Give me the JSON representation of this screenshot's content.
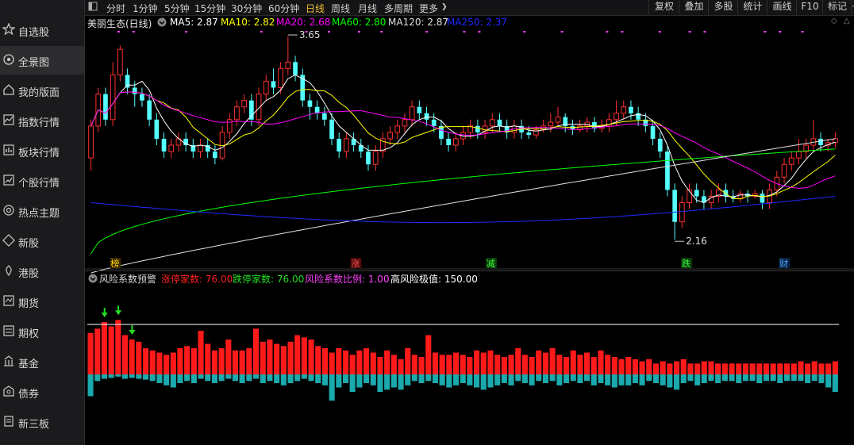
{
  "sidebar": {
    "items": [
      {
        "label": "自选股",
        "icon": "star-icon",
        "active": false
      },
      {
        "label": "全景图",
        "icon": "globe-icon",
        "active": true
      },
      {
        "label": "我的版面",
        "icon": "home-icon",
        "active": false
      },
      {
        "label": "指数行情",
        "icon": "index-chart-icon",
        "active": false
      },
      {
        "label": "板块行情",
        "icon": "block-icon",
        "active": false
      },
      {
        "label": "个股行情",
        "icon": "stock-icon",
        "active": false
      },
      {
        "label": "热点主题",
        "icon": "target-icon",
        "active": false
      },
      {
        "label": "新股",
        "icon": "new-icon",
        "active": false
      },
      {
        "label": "港股",
        "icon": "hk-icon",
        "active": false
      },
      {
        "label": "期货",
        "icon": "futures-icon",
        "active": false
      },
      {
        "label": "期权",
        "icon": "options-icon",
        "active": false
      },
      {
        "label": "基金",
        "icon": "fund-icon",
        "active": false
      },
      {
        "label": "债券",
        "icon": "bond-icon",
        "active": false
      },
      {
        "label": "新三板",
        "icon": "neeq-icon",
        "active": false
      }
    ]
  },
  "toolbar": {
    "periods": [
      "分时",
      "1分钟",
      "5分钟",
      "15分钟",
      "30分钟",
      "60分钟",
      "日线",
      "周线",
      "月线",
      "多周期",
      "更多"
    ],
    "active_period": "日线",
    "right_buttons": [
      "复权",
      "叠加",
      "多股",
      "统计",
      "画线",
      "F10",
      "标记",
      "+自"
    ]
  },
  "colors": {
    "up": "#ff3030",
    "down": "#54ffff",
    "ma5": "#ffffff",
    "ma10": "#ffff00",
    "ma20": "#ff00ff",
    "ma60": "#00ff00",
    "ma120": "#e0e0e0",
    "ma250": "#1f2bff",
    "risk_up": "#ff1a1a",
    "risk_down": "#1aa9ad",
    "active": "#f0c030"
  },
  "indicator_main": {
    "title": "美丽生态(日线)",
    "items": [
      {
        "label": "MA5: 2.87",
        "color": "#ffffff"
      },
      {
        "label": "MA10: 2.82",
        "color": "#ffff00"
      },
      {
        "label": "MA20: 2.68",
        "color": "#ff00ff"
      },
      {
        "label": "MA60: 2.80",
        "color": "#00ff00"
      },
      {
        "label": "MA120: 2.87",
        "color": "#e0e0e0"
      },
      {
        "label": "MA250: 2.37",
        "color": "#1f2bff"
      }
    ]
  },
  "indicator_sub": {
    "title": "风险系数预警",
    "items": [
      {
        "label": "涨停家数: 76.00",
        "color": "#ff2020"
      },
      {
        "label": "跌停家数: 76.00",
        "color": "#20e020"
      },
      {
        "label": "风险系数比例: 1.00",
        "color": "#ff40ff"
      },
      {
        "label": "高风险极值: 150.00",
        "color": "#ffffff"
      }
    ]
  },
  "chart_data": [
    {
      "type": "candlestick",
      "title": "美丽生态(日线)",
      "price_range": [
        2.0,
        3.8
      ],
      "annotations": [
        {
          "text": "3.65",
          "kind": "max"
        },
        {
          "text": "2.16",
          "kind": "min"
        }
      ],
      "event_markers": [
        "榜",
        "涨",
        "减",
        "跌",
        "财"
      ],
      "candles": [
        [
          2.8,
          3.05,
          3.1,
          2.7
        ],
        [
          3.05,
          3.3,
          3.35,
          3.0
        ],
        [
          3.3,
          3.1,
          3.35,
          3.05
        ],
        [
          3.1,
          3.45,
          3.55,
          3.05
        ],
        [
          3.45,
          3.65,
          3.68,
          3.4
        ],
        [
          3.45,
          3.35,
          3.5,
          3.3
        ],
        [
          3.35,
          3.3,
          3.4,
          3.2
        ],
        [
          3.3,
          3.25,
          3.35,
          3.2
        ],
        [
          3.25,
          3.1,
          3.3,
          3.05
        ],
        [
          3.1,
          2.95,
          3.15,
          2.9
        ],
        [
          2.95,
          2.85,
          3.0,
          2.8
        ],
        [
          2.85,
          2.9,
          2.95,
          2.8
        ],
        [
          2.9,
          2.95,
          3.0,
          2.85
        ],
        [
          2.95,
          2.9,
          3.0,
          2.85
        ],
        [
          2.9,
          2.85,
          2.95,
          2.8
        ],
        [
          2.85,
          2.9,
          2.95,
          2.8
        ],
        [
          2.9,
          2.85,
          2.95,
          2.8
        ],
        [
          2.85,
          2.8,
          2.9,
          2.75
        ],
        [
          2.8,
          3.0,
          3.05,
          2.78
        ],
        [
          3.0,
          3.1,
          3.15,
          2.95
        ],
        [
          3.1,
          3.2,
          3.25,
          3.05
        ],
        [
          3.2,
          3.25,
          3.3,
          3.15
        ],
        [
          3.25,
          3.1,
          3.3,
          3.05
        ],
        [
          3.1,
          3.3,
          3.35,
          3.05
        ],
        [
          3.3,
          3.4,
          3.45,
          3.25
        ],
        [
          3.4,
          3.35,
          3.5,
          3.3
        ],
        [
          3.35,
          3.5,
          3.55,
          3.3
        ],
        [
          3.5,
          3.55,
          3.75,
          3.45
        ],
        [
          3.55,
          3.45,
          3.6,
          3.4
        ],
        [
          3.45,
          3.25,
          3.5,
          3.2
        ],
        [
          3.25,
          3.2,
          3.3,
          3.1
        ],
        [
          3.2,
          3.15,
          3.25,
          3.1
        ],
        [
          3.15,
          3.1,
          3.2,
          3.05
        ],
        [
          3.1,
          2.95,
          3.15,
          2.9
        ],
        [
          2.95,
          2.85,
          3.0,
          2.8
        ],
        [
          2.85,
          2.95,
          3.0,
          2.8
        ],
        [
          2.95,
          2.9,
          3.0,
          2.85
        ],
        [
          2.9,
          2.85,
          2.95,
          2.8
        ],
        [
          2.85,
          2.75,
          2.9,
          2.7
        ],
        [
          2.75,
          2.85,
          2.9,
          2.7
        ],
        [
          2.85,
          2.95,
          3.0,
          2.8
        ],
        [
          2.95,
          3.0,
          3.05,
          2.9
        ],
        [
          3.0,
          3.05,
          3.1,
          2.95
        ],
        [
          3.05,
          3.1,
          3.15,
          3.0
        ],
        [
          3.1,
          3.2,
          3.25,
          3.05
        ],
        [
          3.2,
          3.15,
          3.25,
          3.1
        ],
        [
          3.15,
          3.1,
          3.2,
          3.05
        ],
        [
          3.1,
          3.05,
          3.15,
          3.0
        ],
        [
          3.05,
          2.95,
          3.1,
          2.9
        ],
        [
          2.95,
          2.9,
          3.0,
          2.85
        ],
        [
          2.9,
          2.95,
          3.0,
          2.85
        ],
        [
          2.95,
          3.0,
          3.05,
          2.9
        ],
        [
          3.0,
          3.05,
          3.1,
          2.95
        ],
        [
          3.05,
          3.0,
          3.1,
          2.95
        ],
        [
          3.0,
          3.05,
          3.1,
          2.95
        ],
        [
          3.05,
          3.1,
          3.15,
          3.0
        ],
        [
          3.1,
          3.05,
          3.15,
          3.0
        ],
        [
          3.05,
          3.0,
          3.1,
          2.95
        ],
        [
          3.0,
          3.05,
          3.1,
          2.95
        ],
        [
          3.05,
          3.0,
          3.1,
          2.95
        ],
        [
          3.0,
          2.98,
          3.05,
          2.95
        ],
        [
          2.98,
          3.02,
          3.05,
          2.95
        ],
        [
          3.02,
          3.05,
          3.1,
          3.0
        ],
        [
          3.05,
          3.08,
          3.15,
          3.0
        ],
        [
          3.08,
          3.12,
          3.2,
          3.05
        ],
        [
          3.12,
          3.05,
          3.15,
          3.0
        ],
        [
          3.05,
          3.02,
          3.1,
          2.98
        ],
        [
          3.02,
          3.05,
          3.1,
          3.0
        ],
        [
          3.05,
          3.08,
          3.12,
          3.0
        ],
        [
          3.08,
          3.03,
          3.12,
          3.0
        ],
        [
          3.03,
          3.05,
          3.1,
          3.0
        ],
        [
          3.05,
          3.1,
          3.15,
          3.0
        ],
        [
          3.1,
          3.15,
          3.25,
          3.05
        ],
        [
          3.15,
          3.2,
          3.25,
          3.1
        ],
        [
          3.2,
          3.15,
          3.25,
          3.1
        ],
        [
          3.15,
          3.1,
          3.2,
          3.05
        ],
        [
          3.1,
          3.05,
          3.15,
          3.0
        ],
        [
          3.05,
          2.95,
          3.1,
          2.9
        ],
        [
          2.95,
          2.85,
          3.0,
          2.8
        ],
        [
          2.85,
          2.55,
          2.9,
          2.5
        ],
        [
          2.55,
          2.3,
          2.6,
          2.16
        ],
        [
          2.3,
          2.45,
          2.5,
          2.25
        ],
        [
          2.45,
          2.55,
          2.6,
          2.4
        ],
        [
          2.55,
          2.5,
          2.6,
          2.45
        ],
        [
          2.5,
          2.45,
          2.55,
          2.4
        ],
        [
          2.45,
          2.5,
          2.55,
          2.4
        ],
        [
          2.5,
          2.55,
          2.6,
          2.45
        ],
        [
          2.55,
          2.5,
          2.6,
          2.45
        ],
        [
          2.5,
          2.48,
          2.55,
          2.45
        ],
        [
          2.48,
          2.52,
          2.55,
          2.45
        ],
        [
          2.52,
          2.5,
          2.55,
          2.45
        ],
        [
          2.5,
          2.52,
          2.55,
          2.48
        ],
        [
          2.52,
          2.45,
          2.55,
          2.4
        ],
        [
          2.45,
          2.55,
          2.6,
          2.4
        ],
        [
          2.55,
          2.65,
          2.7,
          2.5
        ],
        [
          2.65,
          2.75,
          2.8,
          2.6
        ],
        [
          2.75,
          2.8,
          2.85,
          2.7
        ],
        [
          2.8,
          2.85,
          2.95,
          2.75
        ],
        [
          2.85,
          2.9,
          2.95,
          2.8
        ],
        [
          2.9,
          2.95,
          3.1,
          2.85
        ],
        [
          2.95,
          2.9,
          3.0,
          2.85
        ],
        [
          2.9,
          2.92,
          2.95,
          2.85
        ],
        [
          2.92,
          2.95,
          3.0,
          2.88
        ]
      ]
    },
    {
      "type": "bar",
      "title": "风险系数预警",
      "series": [
        {
          "name": "涨停家数",
          "values": [
            95,
            105,
            120,
            110,
            125,
            90,
            80,
            75,
            60,
            55,
            50,
            45,
            50,
            60,
            65,
            60,
            100,
            70,
            55,
            60,
            80,
            55,
            55,
            60,
            105,
            75,
            80,
            70,
            65,
            75,
            90,
            85,
            80,
            65,
            60,
            50,
            60,
            55,
            45,
            55,
            60,
            50,
            40,
            55,
            45,
            35,
            60,
            45,
            40,
            90,
            50,
            45,
            45,
            50,
            45,
            40,
            55,
            50,
            55,
            45,
            40,
            45,
            60,
            45,
            40,
            55,
            50,
            60,
            45,
            40,
            55,
            45,
            50,
            40,
            55,
            45,
            40,
            35,
            40,
            35,
            30,
            35,
            25,
            30,
            25,
            30,
            35,
            25,
            25,
            30,
            30,
            25,
            25,
            25,
            25,
            25,
            25,
            25,
            25,
            25,
            25,
            25,
            25,
            30,
            25,
            30,
            25,
            25,
            30
          ]
        },
        {
          "name": "跌停家数",
          "values": [
            50,
            15,
            10,
            8,
            5,
            10,
            8,
            10,
            12,
            15,
            20,
            25,
            30,
            20,
            15,
            20,
            10,
            15,
            20,
            15,
            10,
            15,
            20,
            15,
            10,
            20,
            15,
            20,
            25,
            20,
            15,
            10,
            15,
            20,
            25,
            60,
            30,
            20,
            40,
            30,
            20,
            25,
            40,
            35,
            30,
            35,
            25,
            15,
            20,
            15,
            20,
            25,
            30,
            25,
            20,
            25,
            30,
            35,
            30,
            25,
            20,
            25,
            15,
            20,
            25,
            15,
            20,
            15,
            25,
            20,
            15,
            20,
            15,
            25,
            20,
            25,
            30,
            25,
            25,
            20,
            25,
            15,
            20,
            25,
            30,
            35,
            20,
            15,
            25,
            20,
            15,
            20,
            15,
            15,
            20,
            15,
            15,
            20,
            15,
            15,
            20,
            15,
            15,
            15,
            20,
            15,
            20,
            30,
            40
          ]
        }
      ],
      "threshold_label": "高风险极值: 150.00"
    }
  ]
}
